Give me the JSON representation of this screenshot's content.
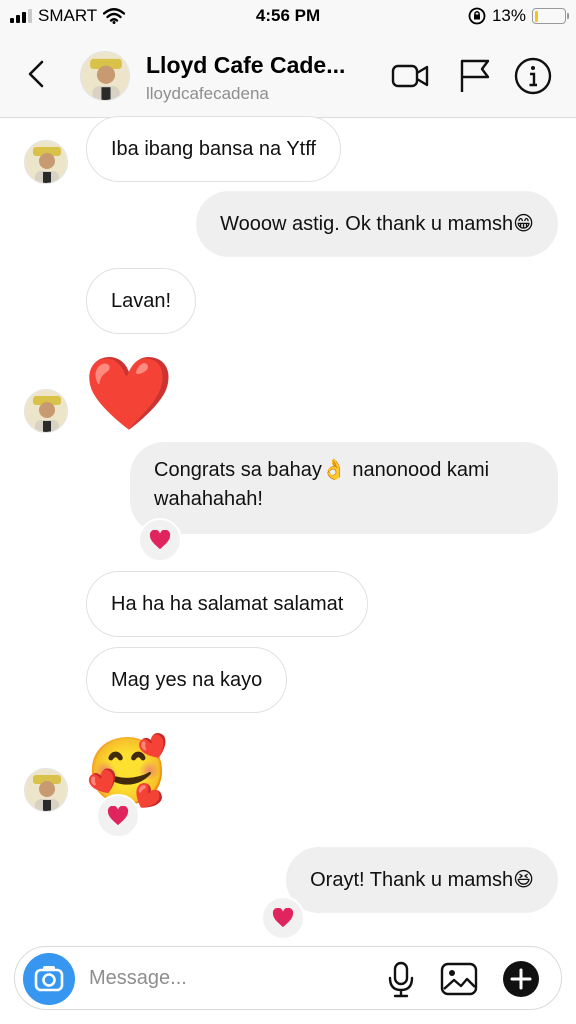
{
  "status_bar": {
    "carrier": "SMART",
    "time": "4:56 PM",
    "battery_percent": "13%",
    "battery_level": 0.13,
    "signal_bars": 3,
    "icons": [
      "signal-icon",
      "wifi-icon",
      "orientation-lock-icon",
      "battery-icon"
    ]
  },
  "header": {
    "name": "Lloyd Cafe Cade...",
    "username": "lloydcafecadena",
    "icons": [
      "back-chevron-icon",
      "video-call-icon",
      "flag-icon",
      "info-icon"
    ]
  },
  "messages": [
    {
      "side": "in",
      "text": "Iba ibang bansa na Ytff"
    },
    {
      "side": "out",
      "text": "Wooow astig. Ok thank u mamsh😁"
    },
    {
      "side": "in",
      "text": "Lavan!"
    },
    {
      "side": "in",
      "text": "❤️"
    },
    {
      "side": "out",
      "text": "Congrats sa bahay👌 nanonood kami wahahahah!",
      "reaction": "❤️"
    },
    {
      "side": "in",
      "text": "Ha ha ha salamat salamat"
    },
    {
      "side": "in",
      "text": "Mag yes na kayo"
    },
    {
      "side": "in",
      "text": "🥰",
      "reaction": "❤️"
    },
    {
      "side": "out",
      "text": "Orayt! Thank u mamsh😆",
      "reaction": "❤️"
    }
  ],
  "composer": {
    "placeholder": "Message...",
    "icons": [
      "camera-icon",
      "microphone-icon",
      "gallery-icon",
      "plus-icon"
    ]
  },
  "colors": {
    "accent": "#3797f0",
    "incoming_border": "#e1e1e1",
    "outgoing_bg": "#efefef",
    "heart": "#e0245e",
    "battery": "#f5c518"
  }
}
